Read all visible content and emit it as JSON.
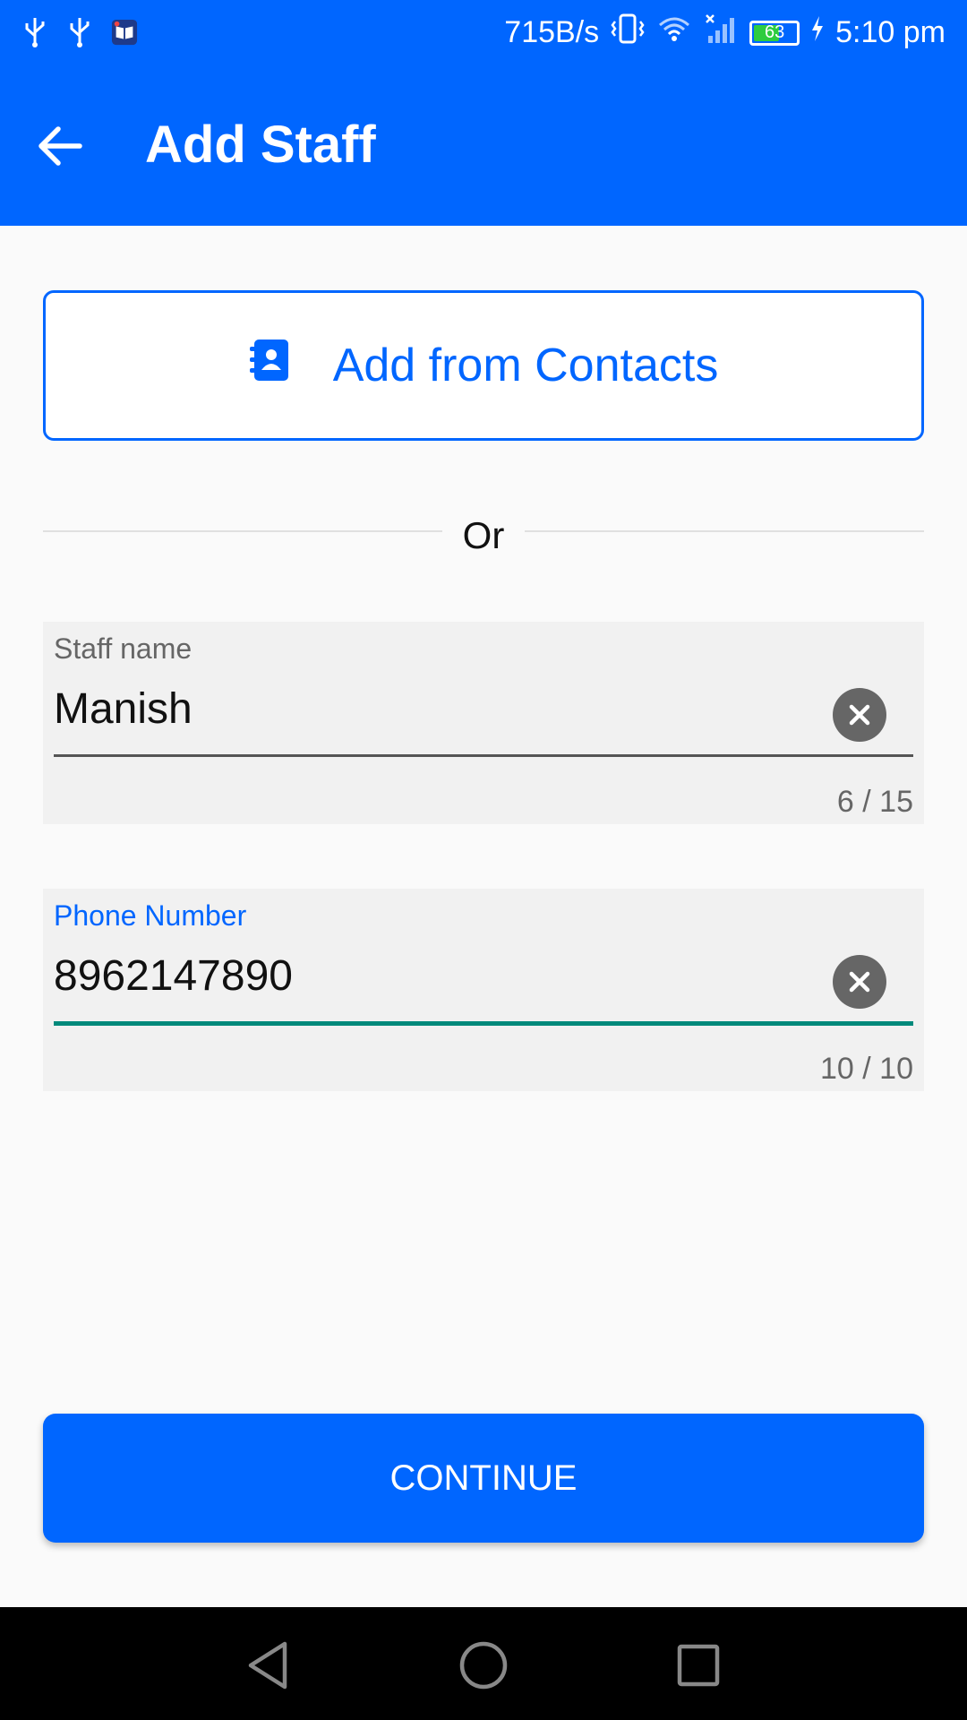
{
  "status_bar": {
    "network_speed": "715B/s",
    "battery_level": "63",
    "battery_fraction": 0.63,
    "time": "5:10 pm",
    "icons": [
      "usb-icon",
      "usb-icon",
      "book-app-icon",
      "vibrate-icon",
      "wifi-icon",
      "signal-icon",
      "battery-icon",
      "charging-icon"
    ]
  },
  "app_bar": {
    "title": "Add Staff",
    "back_icon": "arrow-back-icon"
  },
  "contacts_button": {
    "label": "Add from Contacts",
    "icon": "contacts-book-icon"
  },
  "divider": {
    "text": "Or"
  },
  "staff_name_field": {
    "label": "Staff name",
    "value": "Manish",
    "counter": "6 / 15",
    "clear_icon": "clear-icon"
  },
  "phone_field": {
    "label": "Phone Number",
    "value": "8962147890",
    "counter": "10 / 10",
    "clear_icon": "clear-icon"
  },
  "continue_button": {
    "label": "CONTINUE"
  },
  "nav_bar": {
    "buttons": [
      "back-triangle-icon",
      "home-circle-icon",
      "recents-square-icon"
    ]
  },
  "colors": {
    "primary": "#0066ff",
    "focus_underline": "#00897b",
    "background": "#fafafa",
    "field_background": "#f1f1f1"
  }
}
